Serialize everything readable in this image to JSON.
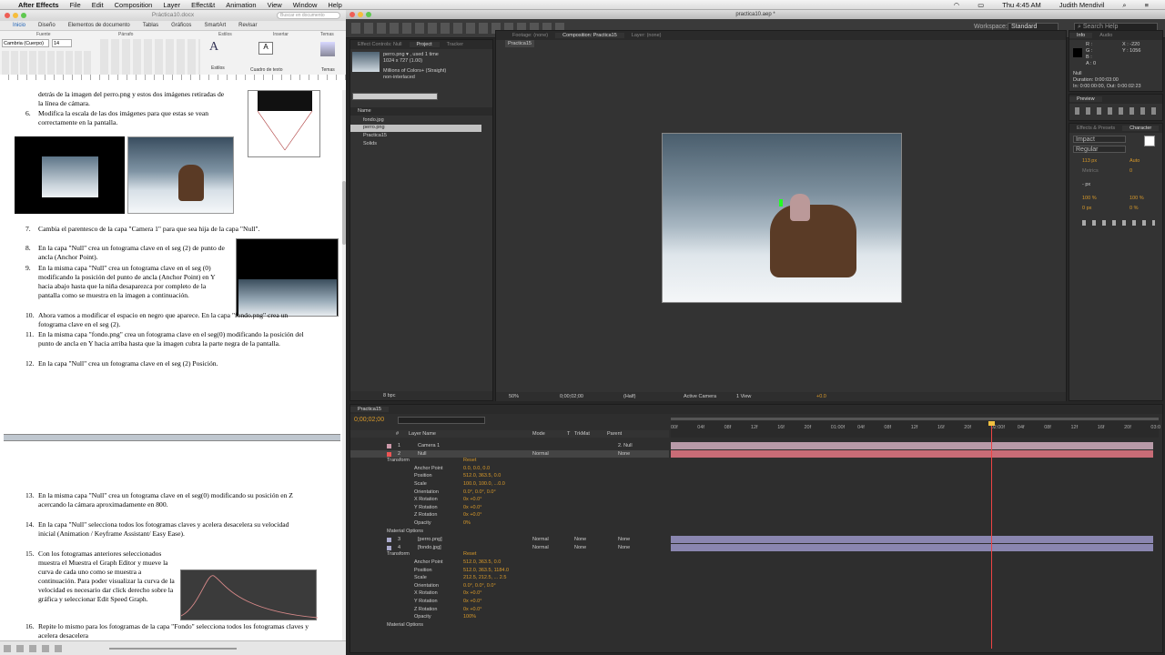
{
  "menubar": {
    "apple": "",
    "app": "After Effects",
    "items": [
      "File",
      "Edit",
      "Composition",
      "Layer",
      "Effect&t",
      "Animation",
      "View",
      "Window",
      "Help"
    ],
    "clock": "Thu 4:45 AM",
    "user": "Judith Mendivil"
  },
  "word": {
    "title": "Práctica10.docx",
    "search_placeholder": "Buscar en documento",
    "tabs": [
      "Inicio",
      "Diseño",
      "Elementos de documento",
      "Tablas",
      "Gráficos",
      "SmartArt",
      "Revisar"
    ],
    "groups": [
      "Fuente",
      "Párrafo",
      "Estilos",
      "Insertar",
      "Temas"
    ],
    "font": "Cambria (Cuerpo)",
    "size": "14",
    "styles_label": "Estilos",
    "textbox_label": "Cuadro de texto",
    "themes_label": "Temas",
    "paras": {
      "p5": "detrás de la imagen del perro.png y estos dos imágenes retiradas de la línea de cámara.",
      "n6": "6.",
      "p6": "Modifica la escala de las dos imágenes para que estas se vean correctamente en la pantalla.",
      "n7": "7.",
      "p7": "Cambia el parentesco de la capa \"Camera 1\" para que sea hija de la capa \"Null\".",
      "n8": "8.",
      "p8": "En la capa \"Null\" crea un fotograma clave en el seg (2) de punto de ancla (Anchor Point).",
      "n9": "9.",
      "p9": "En la misma capa \"Null\" crea un fotograma clave en el seg (0) modificando la posición del punto de ancla (Anchor Point) en Y hacia abajo hasta que la niña desaparezca por completo de la pantalla como se muestra en la imagen a continuación.",
      "n10": "10.",
      "p10": "Ahora vamos a modificar el espacio en negro que aparece. En la capa \"fondo.png\" crea un fotograma clave en el seg (2).",
      "n11": "11.",
      "p11": "En la misma capa \"fondo.png\" crea un fotograma clave en el seg(0) modificando la posición del punto de ancla en Y hacia arriba hasta que la imagen cubra la parte negra de la pantalla.",
      "n12": "12.",
      "p12": "En la capa \"Null\" crea un fotograma clave en el seg (2) Posición.",
      "n13": "13.",
      "p13": "En la misma capa \"Null\" crea un fotograma clave en el seg(0) modificando su posición en Z acercando la cámara aproximadamente en 800.",
      "n14": "14.",
      "p14": "En la capa \"Null\" selecciona todos los fotogramas claves y acelera desacelera su velocidad inicial (Animation / Keyframe Assistant/ Easy Ease).",
      "n15": "15.",
      "p15": "Con los fotogramas anteriores seleccionados muestra el Muestra el Graph Editor y mueve la curva de cada uno como se muestra a continuación. Para poder visualizar la curva de la velocidad es necesario dar click derecho sobre la gráfica y seleccionar Edit Speed Graph.",
      "n16": "16.",
      "p16": "Repite lo mismo para los fotogramas de la capa \"Fondo\" selecciona todos los fotogramas claves y acelera desacelera"
    }
  },
  "ae": {
    "title": "practica10.aep *",
    "workspace_label": "Workspace:",
    "workspace": "Standard",
    "search_help": "Search Help",
    "project_tabs": [
      "Effect Controls: Null",
      "Project",
      "Tracker"
    ],
    "project_item": {
      "name": "perro.png ▾ , used 1 time",
      "dims": "1024 x 727 (1.00)",
      "colors": "Millions of Colors+ (Straight)",
      "interlace": "non-interlaced"
    },
    "project_col": "Name",
    "project_files": [
      "fondo.jpg",
      "perro.png",
      "Practica15",
      "Solids"
    ],
    "bpc": "8 bpc",
    "comp_tabs": [
      "Footage: (none)",
      "Composition: Practica15",
      "Layer: (none)"
    ],
    "comp_sub": "Practica15",
    "viewer": {
      "zoom": "50%",
      "time": "0;00;02;00",
      "res": "(Half)",
      "camera": "Active Camera",
      "view": "1 View",
      "exposure": "+0.0"
    },
    "info": {
      "tabs": [
        "Info",
        "Audio"
      ],
      "r": "R :",
      "g": "G :",
      "b": "B :",
      "a": "A : 0",
      "x": "X : -220",
      "y": "Y : 1056",
      "layer": "Null",
      "duration": "Duration: 0:00:03:00",
      "inout": "In: 0:00:00:00, Out: 0:00:02:23"
    },
    "preview_label": "Preview",
    "char_tabs": [
      "Effects & Presets",
      "Character"
    ],
    "font": "Impact",
    "style": "Regular",
    "char_vals": {
      "size": "113 px",
      "leading": "Auto",
      "kerning": "Metrics",
      "tracking": "0",
      "stroke": "- px",
      "vscale": "100 %",
      "hscale": "100 %",
      "baseline": "0 px",
      "tsume": "0 %"
    },
    "tl_tab": "Practica15",
    "tl_time": "0;00;02;00",
    "tl_cols": [
      "#",
      "Layer Name",
      "Mode",
      "T",
      "TrkMat",
      "Parent"
    ],
    "ruler": [
      "00f",
      "04f",
      "08f",
      "12f",
      "16f",
      "20f",
      "01:00f",
      "04f",
      "08f",
      "12f",
      "16f",
      "20f",
      "02:00f",
      "04f",
      "08f",
      "12f",
      "16f",
      "20f",
      "03:0"
    ],
    "layers": [
      {
        "num": "1",
        "name": "Camera 1",
        "mode": "",
        "trk": "",
        "parent": "2. Null"
      },
      {
        "num": "2",
        "name": "Null",
        "mode": "Normal",
        "trk": "",
        "parent": "None"
      },
      {
        "num": "3",
        "name": "[perro.png]",
        "mode": "Normal",
        "trk": "None",
        "parent": "None"
      },
      {
        "num": "4",
        "name": "[fondo.jpg]",
        "mode": "Normal",
        "trk": "None",
        "parent": "None"
      }
    ],
    "transform_label": "Transform",
    "reset": "Reset",
    "material": "Material Options",
    "null_props": [
      {
        "n": "Anchor Point",
        "v": "0.0, 0.0, 0.0"
      },
      {
        "n": "Position",
        "v": "512.0, 363.5, 0.0"
      },
      {
        "n": "Scale",
        "v": "100.0, 100.0, ...0.0"
      },
      {
        "n": "Orientation",
        "v": "0.0°, 0.0°, 0.0°"
      },
      {
        "n": "X Rotation",
        "v": "0x +0.0°"
      },
      {
        "n": "Y Rotation",
        "v": "0x +0.0°"
      },
      {
        "n": "Z Rotation",
        "v": "0x +0.0°"
      },
      {
        "n": "Opacity",
        "v": "0%"
      }
    ],
    "fondo_props": [
      {
        "n": "Anchor Point",
        "v": "512.0, 363.5, 0.0"
      },
      {
        "n": "Position",
        "v": "512.0, 363.5, 1184.0"
      },
      {
        "n": "Scale",
        "v": "212.5, 212.5, ... 2.5"
      },
      {
        "n": "Orientation",
        "v": "0.0°, 0.0°, 0.0°"
      },
      {
        "n": "X Rotation",
        "v": "0x +0.0°"
      },
      {
        "n": "Y Rotation",
        "v": "0x +0.0°"
      },
      {
        "n": "Z Rotation",
        "v": "0x +0.0°"
      },
      {
        "n": "Opacity",
        "v": "100%"
      }
    ]
  }
}
